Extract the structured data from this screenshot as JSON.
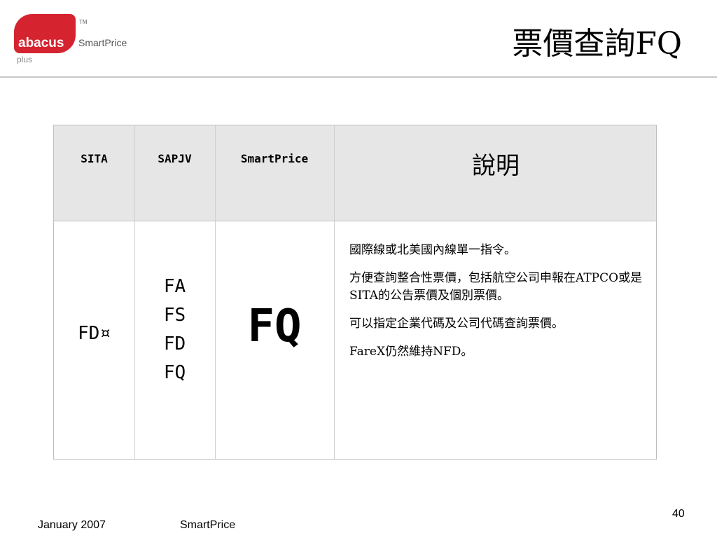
{
  "logo": {
    "word": "abacus",
    "sub": "plus",
    "brand": "SmartPrice",
    "tm": "TM"
  },
  "title": "票價查詢FQ",
  "table": {
    "headers": [
      "SITA",
      "SAPJV",
      "SmartPrice",
      "說明"
    ],
    "sita_cell": "FD¤",
    "sapjv_cell": [
      "FA",
      "FS",
      "FD",
      "FQ"
    ],
    "smartprice_cell": "FQ",
    "description": [
      "國際線或北美國內線單一指令。",
      "方便查詢整合性票價，包括航空公司申報在ATPCO或是SITA的公告票價及個別票價。",
      "可以指定企業代碼及公司代碼查詢票價。",
      "FareX仍然維持NFD。"
    ]
  },
  "footer": {
    "date": "January 2007",
    "product": "SmartPrice",
    "page": "40"
  }
}
